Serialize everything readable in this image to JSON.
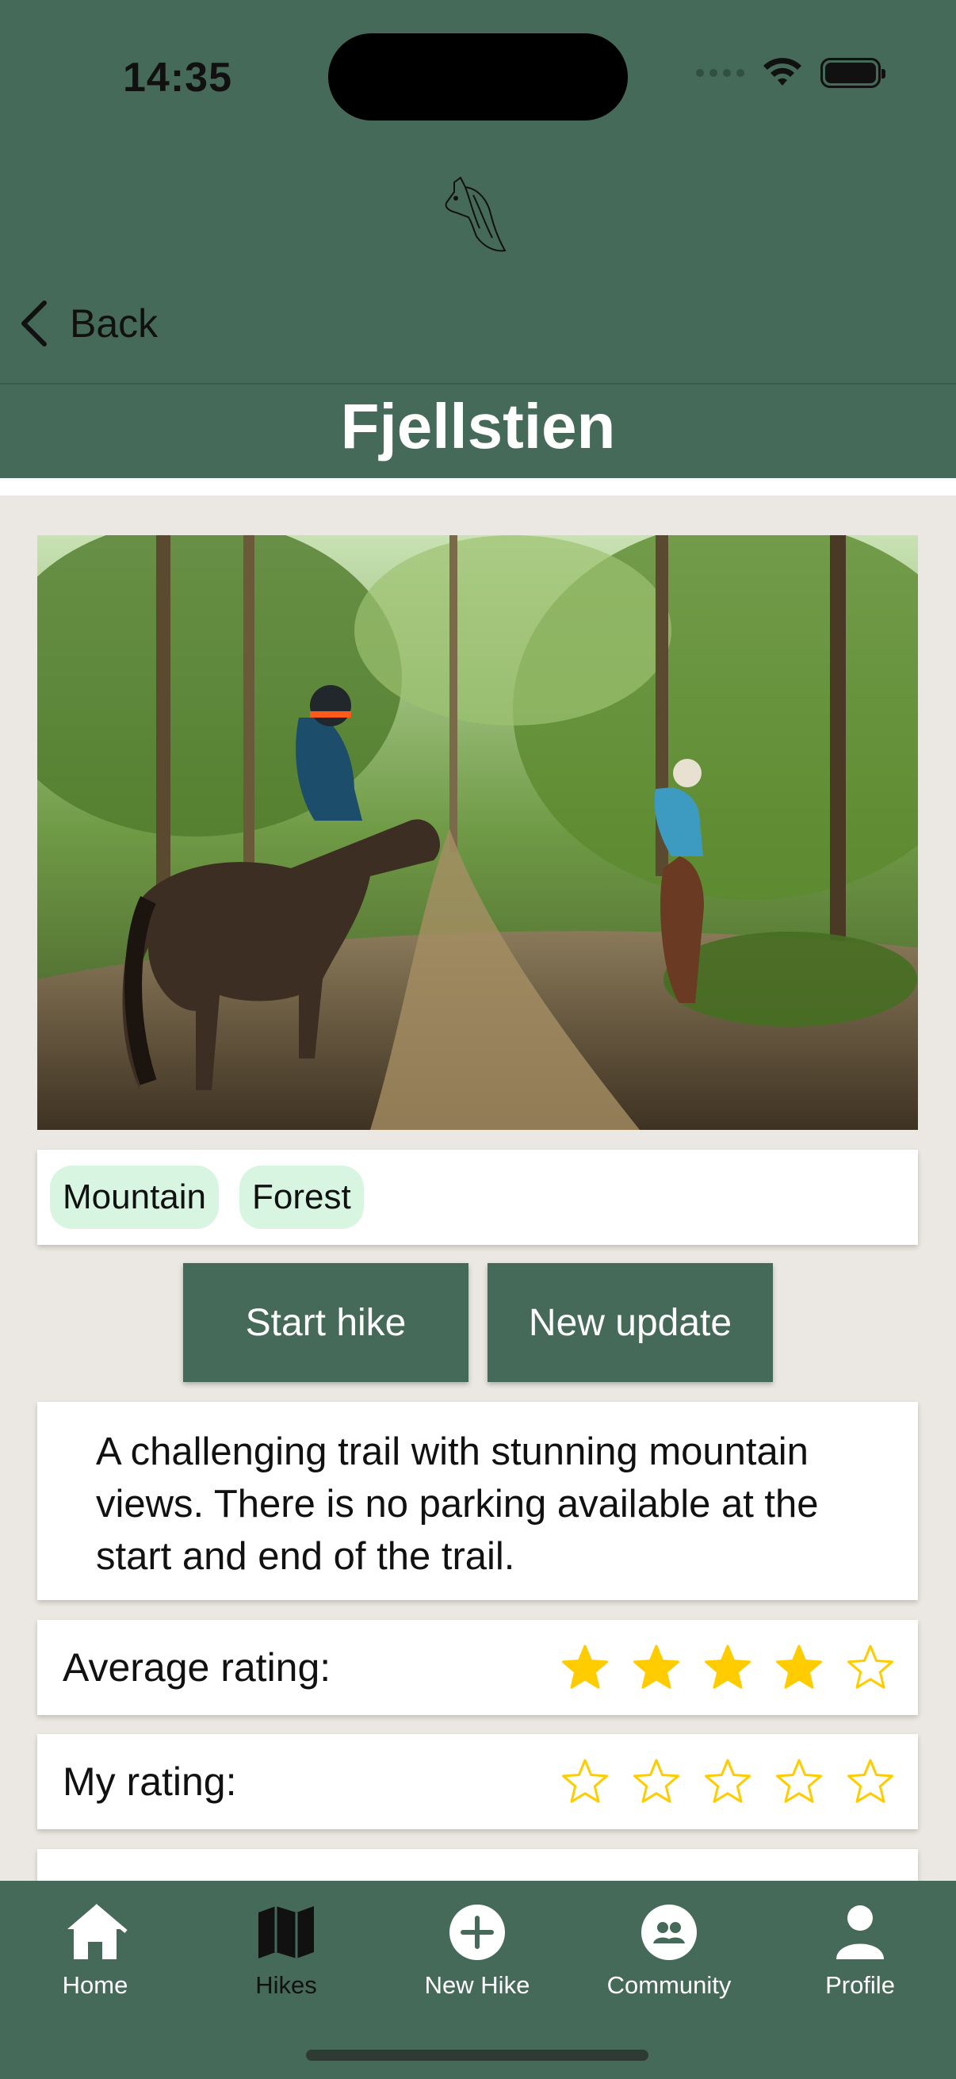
{
  "status_bar": {
    "time": "14:35"
  },
  "nav": {
    "back_label": "Back",
    "title": "Fjellstien"
  },
  "tags": [
    "Mountain",
    "Forest"
  ],
  "actions": {
    "start_label": "Start hike",
    "update_label": "New update"
  },
  "description": "A challenging trail with stunning mountain views. There is no parking available at the start and end of the trail.",
  "ratings": {
    "average_label": "Average rating:",
    "average_value": 4,
    "my_label": "My rating:",
    "my_value": 0,
    "max": 5
  },
  "tabbar": {
    "items": [
      {
        "label": "Home",
        "icon": "home-icon"
      },
      {
        "label": "Hikes",
        "icon": "map-icon"
      },
      {
        "label": "New Hike",
        "icon": "plus-circle-icon"
      },
      {
        "label": "Community",
        "icon": "community-icon"
      },
      {
        "label": "Profile",
        "icon": "person-icon"
      }
    ],
    "active_index": 1
  },
  "colors": {
    "primary": "#466a5a",
    "tag_bg": "#d8f5e1",
    "star": "#ffcc00",
    "page_bg": "#ebe7e2"
  }
}
